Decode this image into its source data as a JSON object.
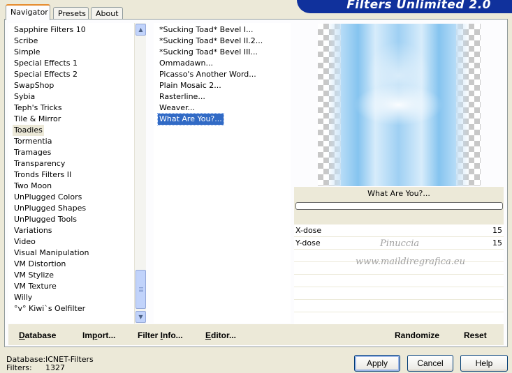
{
  "tabs": [
    {
      "label": "Navigator",
      "active": true
    },
    {
      "label": "Presets",
      "active": false
    },
    {
      "label": "About",
      "active": false
    }
  ],
  "banner": {
    "title": "Filters Unlimited 2.0",
    "color": "#10319c"
  },
  "categories": {
    "items": [
      "Sapphire Filters 10",
      "Scribe",
      "Simple",
      "Special Effects 1",
      "Special Effects 2",
      "SwapShop",
      "Sybia",
      "Teph's Tricks",
      "Tile & Mirror",
      "Toadies",
      "Tormentia",
      "Tramages",
      "Transparency",
      "Tronds Filters II",
      "Two Moon",
      "UnPlugged Colors",
      "UnPlugged Shapes",
      "UnPlugged Tools",
      "Variations",
      "Video",
      "Visual Manipulation",
      "VM Distortion",
      "VM Stylize",
      "VM Texture",
      "Willy",
      "°v° Kiwi`s Oelfilter"
    ],
    "selected_index": 9
  },
  "filters": {
    "items": [
      "*Sucking Toad*  Bevel I...",
      "*Sucking Toad*  Bevel II.2...",
      "*Sucking Toad*  Bevel III...",
      "Ommadawn...",
      "Picasso's Another Word...",
      "Plain Mosaic 2...",
      "Rasterline...",
      "Weaver...",
      "What Are You?..."
    ],
    "selected_index": 8,
    "selected_color": "#316ac5"
  },
  "preview": {
    "filter_name": "What Are You?...",
    "progress": 0
  },
  "params": [
    {
      "label": "X-dose",
      "value": "15"
    },
    {
      "label": "Y-dose",
      "value": "15"
    }
  ],
  "watermark": {
    "line1": "Pinuccia",
    "line2": "www.maildiregrafica.eu"
  },
  "bottom_links": {
    "database": {
      "ul": "D",
      "rest": "atabase"
    },
    "import": {
      "pre": "Im",
      "ul": "p",
      "rest": "ort..."
    },
    "filter_info": {
      "pre": "Filter ",
      "ul": "I",
      "rest": "nfo..."
    },
    "editor": {
      "ul": "E",
      "rest": "ditor..."
    },
    "randomize": "Randomize",
    "reset": "Reset"
  },
  "status": {
    "database_label": "Database:",
    "database_value": "ICNET-Filters",
    "filters_label": "Filters:",
    "filters_value": "1327"
  },
  "buttons": {
    "apply": "Apply",
    "cancel": "Cancel",
    "help": "Help"
  }
}
